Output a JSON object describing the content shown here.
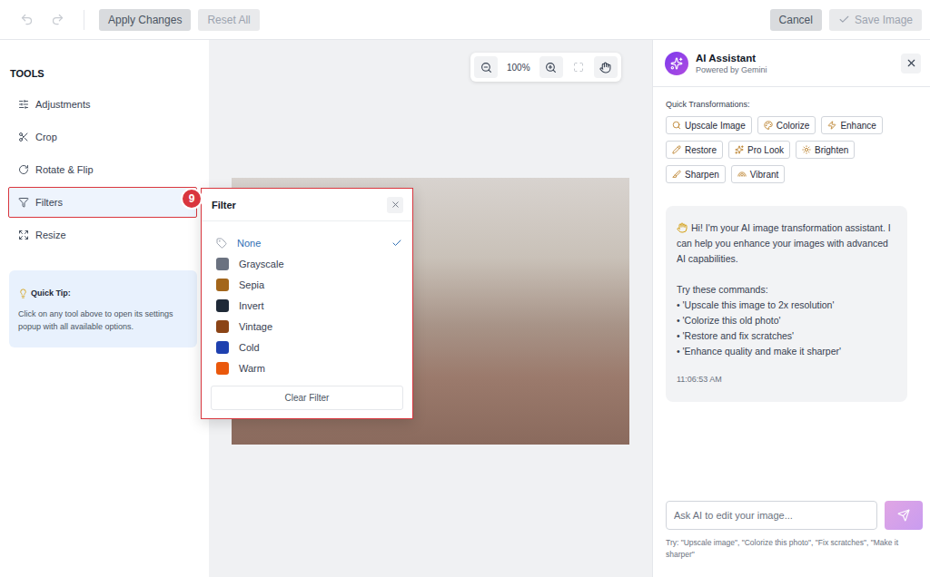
{
  "toolbar": {
    "history": [
      {
        "kind": "undo",
        "disabled": true
      },
      {
        "kind": "redo",
        "disabled": true
      }
    ],
    "left_buttons": [
      {
        "label": "Apply Changes",
        "disabled": false
      },
      {
        "label": "Reset All",
        "disabled": true
      }
    ],
    "right_buttons": [
      {
        "label": "Cancel",
        "kind": "plain",
        "disabled": false
      },
      {
        "label": "Save Image",
        "kind": "check",
        "disabled": true
      }
    ]
  },
  "sidebar": {
    "title": "TOOLS",
    "items": [
      {
        "label": "Adjustments",
        "selected": false
      },
      {
        "label": "Crop",
        "selected": false
      },
      {
        "label": "Rotate & Flip",
        "selected": false
      },
      {
        "label": "Filters",
        "selected": true
      },
      {
        "label": "Resize",
        "selected": false
      }
    ],
    "tip": {
      "title": "Quick Tip:",
      "text": "Click on any tool above to open its settings popup with all available options."
    }
  },
  "zoom": {
    "reading": "100%"
  },
  "annotation": {
    "badge": "9"
  },
  "filter_popup": {
    "title": "Filter",
    "options": [
      {
        "label": "None",
        "kind": "none",
        "selected": true
      },
      {
        "label": "Grayscale",
        "kind": "swatch",
        "selected": false,
        "color": "#6b7280"
      },
      {
        "label": "Sepia",
        "kind": "swatch",
        "selected": false,
        "color": "#a3661b"
      },
      {
        "label": "Invert",
        "kind": "swatch",
        "selected": false,
        "color": "#1f2937"
      },
      {
        "label": "Vintage",
        "kind": "swatch",
        "selected": false,
        "color": "#8b4416"
      },
      {
        "label": "Cold",
        "kind": "swatch",
        "selected": false,
        "color": "#1e40af"
      },
      {
        "label": "Warm",
        "kind": "swatch",
        "selected": false,
        "color": "#ea580c"
      }
    ],
    "clear_button": "Clear Filter"
  },
  "assistant": {
    "title": "AI Assistant",
    "subtitle": "Powered by Gemini",
    "quick_label": "Quick Transformations:",
    "quick_actions": [
      "Upscale Image",
      "Colorize",
      "Enhance",
      "Restore",
      "Pro Look",
      "Brighten",
      "Sharpen",
      "Vibrant"
    ],
    "message": {
      "greeting": "Hi! I'm your AI image transformation assistant. I can help you enhance your images with advanced AI capabilities.",
      "prompt": "Try these commands:",
      "commands": [
        "• 'Upscale this image to 2x resolution'",
        "• 'Colorize this old photo'",
        "• 'Restore and fix scratches'",
        "• 'Enhance quality and make it sharper'"
      ],
      "time": "11:06:53 AM"
    },
    "input": {
      "placeholder": "Ask AI to edit your image..."
    },
    "hint": "Try: \"Upscale image\", \"Colorize this photo\", \"Fix scratches\", \"Make it sharper\""
  }
}
